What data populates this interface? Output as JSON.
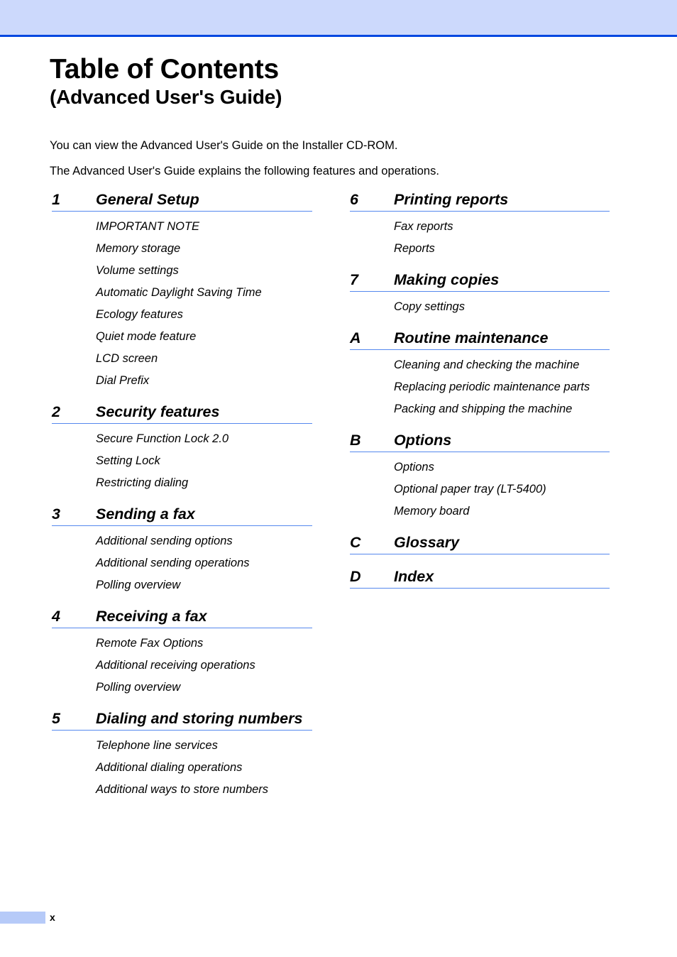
{
  "header": {
    "band_color": "#ccd9fc",
    "rule_color": "#0047e0"
  },
  "title": {
    "main": "Table of Contents",
    "sub": "(Advanced User's Guide)"
  },
  "intro": {
    "line1": "You can view the Advanced User's Guide on the Installer CD-ROM.",
    "line2": "The Advanced User's Guide explains the following features and operations."
  },
  "toc": {
    "rule_color": "#5588ee",
    "left_column": [
      {
        "number": "1",
        "title": "General Setup",
        "entries": [
          "IMPORTANT NOTE",
          "Memory storage",
          "Volume settings",
          "Automatic Daylight Saving Time",
          "Ecology features",
          "Quiet mode feature",
          "LCD screen",
          "Dial Prefix"
        ]
      },
      {
        "number": "2",
        "title": "Security features",
        "entries": [
          "Secure Function Lock 2.0",
          "Setting Lock",
          "Restricting dialing"
        ]
      },
      {
        "number": "3",
        "title": "Sending a fax",
        "entries": [
          "Additional sending options",
          "Additional sending operations",
          "Polling overview"
        ]
      },
      {
        "number": "4",
        "title": "Receiving a fax",
        "entries": [
          "Remote Fax Options",
          "Additional receiving operations",
          "Polling overview"
        ]
      },
      {
        "number": "5",
        "title": "Dialing and storing numbers",
        "entries": [
          "Telephone line services",
          "Additional dialing operations",
          "Additional ways to store numbers"
        ]
      }
    ],
    "right_column": [
      {
        "number": "6",
        "title": "Printing reports",
        "entries": [
          "Fax reports",
          "Reports"
        ]
      },
      {
        "number": "7",
        "title": "Making copies",
        "entries": [
          "Copy settings"
        ]
      },
      {
        "number": "A",
        "title": "Routine maintenance",
        "entries": [
          "Cleaning and checking the machine",
          "Replacing periodic maintenance parts",
          "Packing and shipping the machine"
        ]
      },
      {
        "number": "B",
        "title": "Options",
        "entries": [
          "Options",
          "Optional paper tray (LT-5400)",
          "Memory board"
        ]
      },
      {
        "number": "C",
        "title": "Glossary",
        "entries": []
      },
      {
        "number": "D",
        "title": "Index",
        "entries": []
      }
    ]
  },
  "footer": {
    "page_number": "x",
    "box_color": "#b6caf8"
  }
}
